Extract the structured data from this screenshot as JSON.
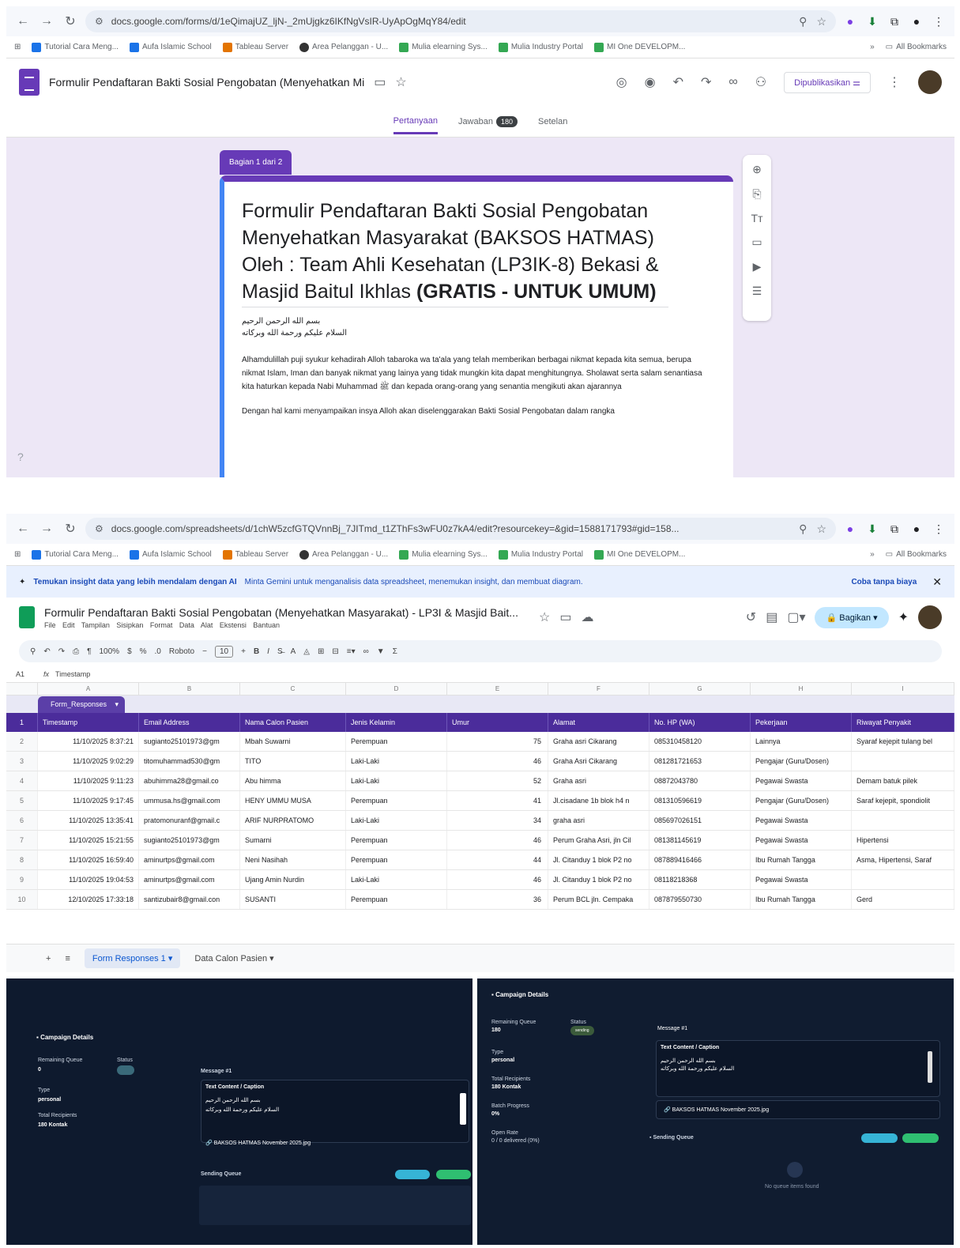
{
  "browser": {
    "forms_url": "docs.google.com/forms/d/1eQimajUZ_ljN-_2mUjgkz6IKfNgVsIR-UyApOgMqY84/edit",
    "sheets_url": "docs.google.com/spreadsheets/d/1chW5zcfGTQVnnBj_7JITmd_t1ZThFs3wFU0z7kA4/edit?resourcekey=&gid=1588171793#gid=158...",
    "bookmarks": [
      "Tutorial Cara Meng...",
      "Aufa Islamic School",
      "Tableau Server",
      "Area Pelanggan - U...",
      "Mulia elearning Sys...",
      "Mulia Industry Portal",
      "MI One DEVELOPM..."
    ],
    "all_bookmarks": "All Bookmarks"
  },
  "forms": {
    "doc_title": "Formulir Pendaftaran Bakti Sosial Pengobatan (Menyehatkan Mi",
    "publish_label": "Dipublikasikan",
    "tabs": {
      "questions": "Pertanyaan",
      "responses": "Jawaban",
      "responses_count": "180",
      "settings": "Setelan"
    },
    "section_label": "Bagian 1 dari 2",
    "form_title": "Formulir Pendaftaran Bakti Sosial Pengobatan Menyehatkan Masyarakat (BAKSOS HATMAS) Oleh : Team Ahli Kesehatan (LP3IK-8) Bekasi & Masjid Baitul Ikhlas ",
    "form_title_bold": "(GRATIS - UNTUK UMUM)",
    "arabic1": "بسم الله الرحمن الرحيم",
    "arabic2": "السلام عليكم ورحمة الله وبركاته",
    "paragraph1": "Alhamdulillah puji syukur kehadirah Alloh tabaroka wa ta'ala yang telah memberikan berbagai nikmat kepada kita semua, berupa nikmat Islam, Iman dan banyak nikmat yang lainya yang tidak mungkin kita dapat menghitungnya. Sholawat serta salam senantiasa kita haturkan kepada Nabi Muhammad ﷺ dan kepada orang-orang yang senantia mengikuti akan ajarannya",
    "paragraph2": "Dengan hal kami menyampaikan insya Alloh akan diselenggarakan Bakti Sosial Pengobatan dalam rangka"
  },
  "sheets": {
    "banner_text": "Temukan insight data yang lebih mendalam dengan AI",
    "banner_sub": "Minta Gemini untuk menganalisis data spreadsheet, menemukan insight, dan membuat diagram.",
    "banner_cta": "Coba tanpa biaya",
    "doc_title": "Formulir Pendaftaran Bakti Sosial Pengobatan (Menyehatkan Masyarakat) - LP3I & Masjid Bait...",
    "menu": "File Edit Tampilan Sisipkan Format Data Alat Ekstensi Bantuan",
    "share_label": "Bagikan",
    "toolbar": {
      "zoom": "100%",
      "font": "Roboto",
      "size": "10"
    },
    "cell_ref": "A1",
    "formula": "Timestamp",
    "col_letters": [
      "A",
      "B",
      "C",
      "D",
      "E",
      "F",
      "G",
      "H",
      "I"
    ],
    "table_name": "Form_Responses",
    "headers": [
      "Timestamp",
      "Email Address",
      "Nama Calon Pasien",
      "Jenis Kelamin",
      "Umur",
      "Alamat",
      "No. HP (WA)",
      "Pekerjaan",
      "Riwayat Penyakit"
    ],
    "rows": [
      {
        "n": "2",
        "ts": "11/10/2025 8:37:21",
        "email": "sugianto25101973@gm",
        "nama": "Mbah Suwarni",
        "jk": "Perempuan",
        "umur": "75",
        "alamat": "Graha asri Cikarang",
        "hp": "085310458120",
        "kerja": "Lainnya",
        "riwayat": "Syaraf kejepit tulang bel"
      },
      {
        "n": "3",
        "ts": "11/10/2025 9:02:29",
        "email": "titomuhammad530@gm",
        "nama": "TITO",
        "jk": "Laki-Laki",
        "umur": "46",
        "alamat": "Graha Asri Cikarang",
        "hp": "081281721653",
        "kerja": "Pengajar (Guru/Dosen)",
        "riwayat": ""
      },
      {
        "n": "4",
        "ts": "11/10/2025 9:11:23",
        "email": "abuhimma28@gmail.co",
        "nama": "Abu himma",
        "jk": "Laki-Laki",
        "umur": "52",
        "alamat": "Graha asri",
        "hp": "08872043780",
        "kerja": "Pegawai Swasta",
        "riwayat": "Demam batuk pilek"
      },
      {
        "n": "5",
        "ts": "11/10/2025 9:17:45",
        "email": "ummusa.hs@gmail.com",
        "nama": "HENY UMMU MUSA",
        "jk": "Perempuan",
        "umur": "41",
        "alamat": "Jl.cisadane 1b blok h4 n",
        "hp": "081310596619",
        "kerja": "Pengajar (Guru/Dosen)",
        "riwayat": "Saraf kejepit, spondiolit"
      },
      {
        "n": "6",
        "ts": "11/10/2025 13:35:41",
        "email": "pratomonuranf@gmail.c",
        "nama": "ARIF NURPRATOMO",
        "jk": "Laki-Laki",
        "umur": "34",
        "alamat": "graha asri",
        "hp": "085697026151",
        "kerja": "Pegawai Swasta",
        "riwayat": ""
      },
      {
        "n": "7",
        "ts": "11/10/2025 15:21:55",
        "email": "sugianto25101973@gm",
        "nama": "Sumarni",
        "jk": "Perempuan",
        "umur": "46",
        "alamat": "Perum Graha Asri, jln Cil",
        "hp": "081381145619",
        "kerja": "Pegawai Swasta",
        "riwayat": "Hipertensi"
      },
      {
        "n": "8",
        "ts": "11/10/2025 16:59:40",
        "email": "aminurtps@gmail.com",
        "nama": "Neni Nasihah",
        "jk": "Perempuan",
        "umur": "44",
        "alamat": "Jl. Citanduy 1 blok P2 no",
        "hp": "087889416466",
        "kerja": "Ibu Rumah Tangga",
        "riwayat": "Asma, Hipertensi, Saraf"
      },
      {
        "n": "9",
        "ts": "11/10/2025 19:04:53",
        "email": "aminurtps@gmail.com",
        "nama": "Ujang Amin Nurdin",
        "jk": "Laki-Laki",
        "umur": "46",
        "alamat": "Jl. Citanduy 1 blok P2 no",
        "hp": "08118218368",
        "kerja": "Pegawai Swasta",
        "riwayat": ""
      },
      {
        "n": "10",
        "ts": "12/10/2025 17:33:18",
        "email": "santizubair8@gmail.con",
        "nama": "SUSANTI",
        "jk": "Perempuan",
        "umur": "36",
        "alamat": "Perum BCL jln. Cempaka",
        "hp": "087879550730",
        "kerja": "Ibu Rumah Tangga",
        "riwayat": "Gerd"
      }
    ],
    "sheet_tabs": [
      "Form Responses 1",
      "Data Calon Pasien"
    ]
  },
  "campaign_left": {
    "title": "Campaign Details",
    "remaining_label": "Remaining Queue",
    "remaining_value": "0",
    "status_label": "Status",
    "type_label": "Type",
    "type_value": "personal",
    "total_label": "Total Recipients",
    "total_value": "180 Kontak",
    "message_label": "Message #1",
    "text_label": "Text Content / Caption",
    "attachment": "BAKSOS HATMAS November 2025.jpg",
    "queue_label": "Sending Queue"
  },
  "campaign_right": {
    "title": "Campaign Details",
    "remaining_label": "Remaining Queue",
    "remaining_value": "180",
    "status_label": "Status",
    "status_value": "sending",
    "type_label": "Type",
    "type_value": "personal",
    "total_label": "Total Recipients",
    "total_value": "180 Kontak",
    "batch_label": "Batch Progress",
    "batch_value": "0%",
    "open_label": "Open Rate",
    "open_value": "0 / 0 delivered (0%)",
    "message_label": "Message #1",
    "text_label": "Text Content / Caption",
    "attachment": "BAKSOS HATMAS November 2025.jpg",
    "queue_label": "Sending Queue",
    "empty_text": "No queue items found"
  },
  "colors": {
    "forms": "#673ab7",
    "sheets": "#0f9d58",
    "table_header": "#4b2c9b",
    "dark_bg": "#101c30"
  }
}
